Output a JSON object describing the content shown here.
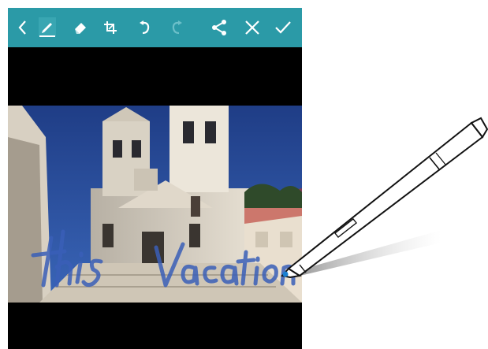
{
  "toolbar": {
    "background": "#2b9aa7",
    "buttons": [
      {
        "name": "back",
        "icon": "chevron-left-icon",
        "active": false
      },
      {
        "name": "pen",
        "icon": "pen-icon",
        "active": true
      },
      {
        "name": "eraser",
        "icon": "eraser-icon",
        "active": false
      },
      {
        "name": "crop",
        "icon": "crop-icon",
        "active": false
      },
      {
        "name": "undo",
        "icon": "undo-icon",
        "active": false
      },
      {
        "name": "redo",
        "icon": "redo-icon",
        "active": false,
        "disabled": true
      },
      {
        "name": "share",
        "icon": "share-icon",
        "active": false
      },
      {
        "name": "discard",
        "icon": "close-icon",
        "active": false
      },
      {
        "name": "done",
        "icon": "check-icon",
        "active": false
      }
    ]
  },
  "canvas": {
    "photo": "church-photo",
    "handwriting": "this Vacation",
    "ink_color": "#3a5fb8"
  },
  "stylus": {
    "icon": "stylus-pen-icon",
    "tip_color": "#1a7fd1"
  }
}
